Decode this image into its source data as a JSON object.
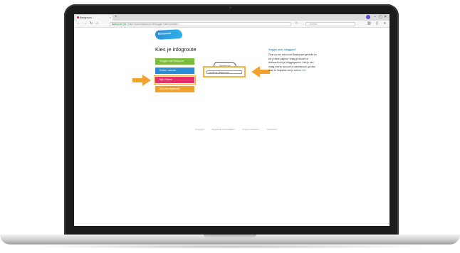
{
  "browser": {
    "tab_title": "Basispoort ...",
    "new_tab": "+",
    "url_site": "Basispoort (NL)",
    "url": "https://www.basispoort.nl/inloggen?nameprovider=...",
    "search_placeholder": "Zoeken",
    "window_controls": [
      "–",
      "▢",
      "✕"
    ],
    "nav_back": "←",
    "nav_forward": "→",
    "nav_reload": "↻",
    "nav_home": "⌂",
    "menu_icon": "≡"
  },
  "page": {
    "logo_text": "Basispoort",
    "title": "Kies je inlogroute",
    "buttons": [
      "Inloggen met Basispoort",
      "Entree / account",
      "Mijn / Entree",
      "Kies een organisatie"
    ],
    "cloud_logo_text": "Basispoort",
    "ll_field_text": "Leerlingen Basispoort",
    "info_title": "Vragen over inloggen?",
    "info_text": "Zit je op een school die Basispoort gebruikt en zie je deze pagina? Vraag je docent of leerkracht om je inloggegevens. Heb je een vraag over je account of wachtwoord, ga dan naar de helpdesk van je school.",
    "info_link": "hier",
    "footer_links": [
      "Copyright",
      "Algemene Voorwaarden",
      "Privacy statement",
      "Disclaimer"
    ]
  },
  "colors": {
    "green": "#7dbb3c",
    "blue": "#2a8cd6",
    "pink": "#e3316d",
    "orange": "#f0a22e",
    "highlight": "#f3b23c"
  }
}
